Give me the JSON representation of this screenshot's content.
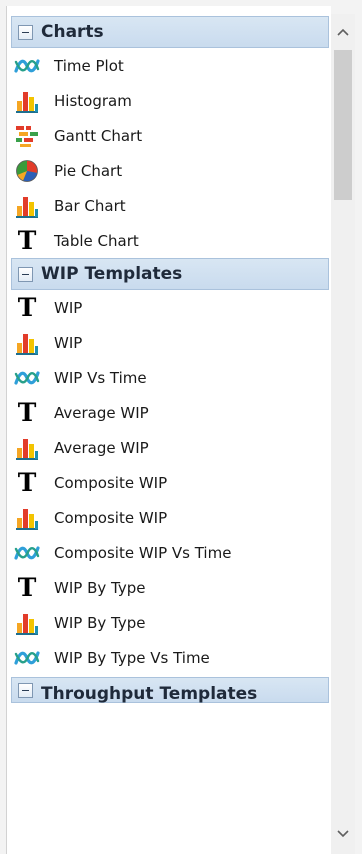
{
  "groups": [
    {
      "title": "Charts",
      "items": [
        {
          "label": "Time Plot",
          "icon": "time-plot-icon"
        },
        {
          "label": "Histogram",
          "icon": "bar-chart-icon"
        },
        {
          "label": "Gantt Chart",
          "icon": "gantt-chart-icon"
        },
        {
          "label": "Pie Chart",
          "icon": "pie-chart-icon"
        },
        {
          "label": "Bar Chart",
          "icon": "bar-chart-icon"
        },
        {
          "label": "Table Chart",
          "icon": "table-t-icon"
        }
      ]
    },
    {
      "title": "WIP Templates",
      "items": [
        {
          "label": "WIP",
          "icon": "table-t-icon"
        },
        {
          "label": "WIP",
          "icon": "bar-chart-icon"
        },
        {
          "label": "WIP Vs Time",
          "icon": "time-plot-icon"
        },
        {
          "label": "Average WIP",
          "icon": "table-t-icon"
        },
        {
          "label": "Average WIP",
          "icon": "bar-chart-icon"
        },
        {
          "label": "Composite WIP",
          "icon": "table-t-icon"
        },
        {
          "label": "Composite WIP",
          "icon": "bar-chart-icon"
        },
        {
          "label": "Composite WIP Vs Time",
          "icon": "time-plot-icon"
        },
        {
          "label": "WIP By Type",
          "icon": "table-t-icon"
        },
        {
          "label": "WIP By Type",
          "icon": "bar-chart-icon"
        },
        {
          "label": "WIP By Type Vs Time",
          "icon": "time-plot-icon"
        }
      ]
    }
  ],
  "partial_group": {
    "title": "Throughput Templates"
  },
  "scrollbar": {
    "up_icon": "chevron-up-icon",
    "down_icon": "chevron-down-icon"
  },
  "colors": {
    "header_bg": "#c9dbee",
    "header_border": "#aac2dc",
    "time_plot_a": "#3aa0d8",
    "time_plot_b": "#2aa08a",
    "bar_red": "#e23c2a",
    "bar_orange": "#f5a623",
    "bar_yellow": "#f3c400"
  }
}
